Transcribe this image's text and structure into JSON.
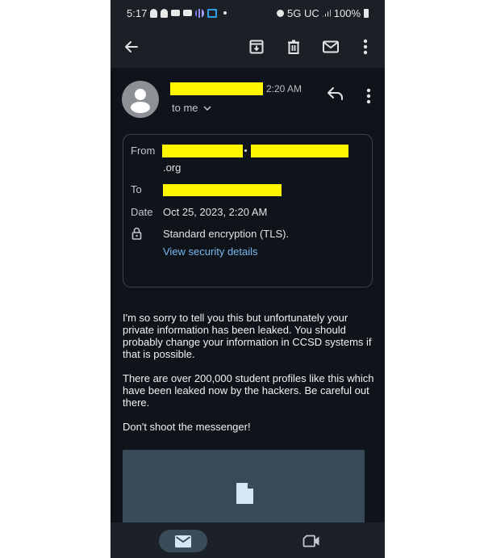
{
  "status_bar": {
    "time": "5:17",
    "network": "5G UC",
    "battery": "100%",
    "notification_icons": [
      "snapchat-icon",
      "snapchat-icon",
      "youtube-icon",
      "youtube-icon",
      "audio-app-icon",
      "app-icon",
      "dot-icon"
    ],
    "system_icons": [
      "alarm-icon",
      "signal-icon",
      "battery-icon"
    ]
  },
  "toolbar": {
    "back": "back-arrow-icon",
    "actions": [
      "archive-icon",
      "delete-icon",
      "mark-unread-icon",
      "more-vert-icon"
    ]
  },
  "message": {
    "sender_redacted": true,
    "time": "2:20 AM",
    "recipient_summary": "to me",
    "details": {
      "from_label": "From",
      "from_suffix": ".org",
      "to_label": "To",
      "date_label": "Date",
      "date_value": "Oct 25, 2023, 2:20 AM",
      "encryption": "Standard encryption (TLS).",
      "security_link": "View security details"
    },
    "body": [
      "I'm so sorry to tell you this but unfortunately your private information has been leaked. You should probably change your information in CCSD systems if that is possible.",
      "There are over 200,000 student profiles like this which have been leaked now by the hackers. Be careful out there.",
      "Don't shoot the messenger!"
    ],
    "attachment_icon": "file-icon"
  },
  "bottom_nav": {
    "items": [
      {
        "name": "mail",
        "icon": "mail-icon",
        "active": true
      },
      {
        "name": "meet",
        "icon": "video-icon",
        "active": false
      }
    ]
  },
  "colors": {
    "redaction": "#fff600",
    "link": "#7ab8f0",
    "background": "#0f131a",
    "bar": "#1b1f26",
    "attachment": "#384a57"
  }
}
